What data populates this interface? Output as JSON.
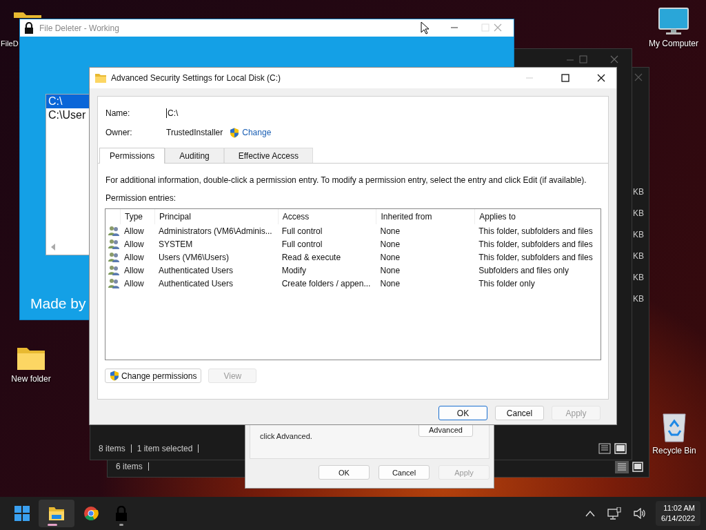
{
  "desktop_icons": [
    {
      "label": "FileD",
      "kind": "folder"
    },
    {
      "label": "My Computer",
      "kind": "monitor"
    },
    {
      "label": "New folder",
      "kind": "folder"
    },
    {
      "label": "Recycle Bin",
      "kind": "bin"
    }
  ],
  "explorer_windows": [
    {
      "status": [
        "8 items",
        "1 item selected"
      ]
    },
    {
      "status": [
        "6 items"
      ],
      "size_column": [
        "KB",
        "KB",
        "KB",
        "KB",
        "KB",
        "KB"
      ]
    }
  ],
  "properties_dialog": {
    "text": "click Advanced.",
    "button": "Advanced",
    "buttons": [
      {
        "label": "OK",
        "disabled": false
      },
      {
        "label": "Cancel",
        "disabled": false
      },
      {
        "label": "Apply",
        "disabled": true
      }
    ]
  },
  "file_deleter": {
    "title": "File Deleter - Working",
    "list": [
      {
        "label": "C:\\",
        "selected": true
      },
      {
        "label": "C:\\User",
        "selected": false
      }
    ],
    "footer": "Made by"
  },
  "dialog": {
    "title": "Advanced Security Settings for Local Disk (C:)",
    "name_label": "Name:",
    "name": "C:\\",
    "owner_label": "Owner:",
    "owner": "TrustedInstaller",
    "change_link": "Change",
    "tabs": [
      {
        "label": "Permissions",
        "selected": true
      },
      {
        "label": "Auditing",
        "selected": false
      },
      {
        "label": "Effective Access",
        "selected": false
      }
    ],
    "info": "For additional information, double-click a permission entry. To modify a permission entry, select the entry and click Edit (if available).",
    "entries_label": "Permission entries:",
    "columns": [
      "Type",
      "Principal",
      "Access",
      "Inherited from",
      "Applies to"
    ],
    "rows": [
      [
        "Allow",
        "Administrators (VM6\\Adminis...",
        "Full control",
        "None",
        "This folder, subfolders and files"
      ],
      [
        "Allow",
        "SYSTEM",
        "Full control",
        "None",
        "This folder, subfolders and files"
      ],
      [
        "Allow",
        "Users (VM6\\Users)",
        "Read & execute",
        "None",
        "This folder, subfolders and files"
      ],
      [
        "Allow",
        "Authenticated Users",
        "Modify",
        "None",
        "Subfolders and files only"
      ],
      [
        "Allow",
        "Authenticated Users",
        "Create folders / appen...",
        "None",
        "This folder only"
      ]
    ],
    "actions": [
      {
        "label": "Change permissions",
        "disabled": false,
        "shield": true
      },
      {
        "label": "View",
        "disabled": true,
        "shield": false
      }
    ],
    "buttons": [
      {
        "label": "OK",
        "default": true,
        "disabled": false
      },
      {
        "label": "Cancel",
        "default": false,
        "disabled": false
      },
      {
        "label": "Apply",
        "default": false,
        "disabled": true
      }
    ]
  },
  "taskbar": {
    "apps": [
      {
        "kind": "start",
        "active": false,
        "running": false
      },
      {
        "kind": "explorer",
        "active": true,
        "running": true
      },
      {
        "kind": "browser",
        "active": false,
        "running": false
      },
      {
        "kind": "lock",
        "active": false,
        "running": true
      }
    ],
    "time": "11:02 AM",
    "date": "6/14/2022"
  }
}
